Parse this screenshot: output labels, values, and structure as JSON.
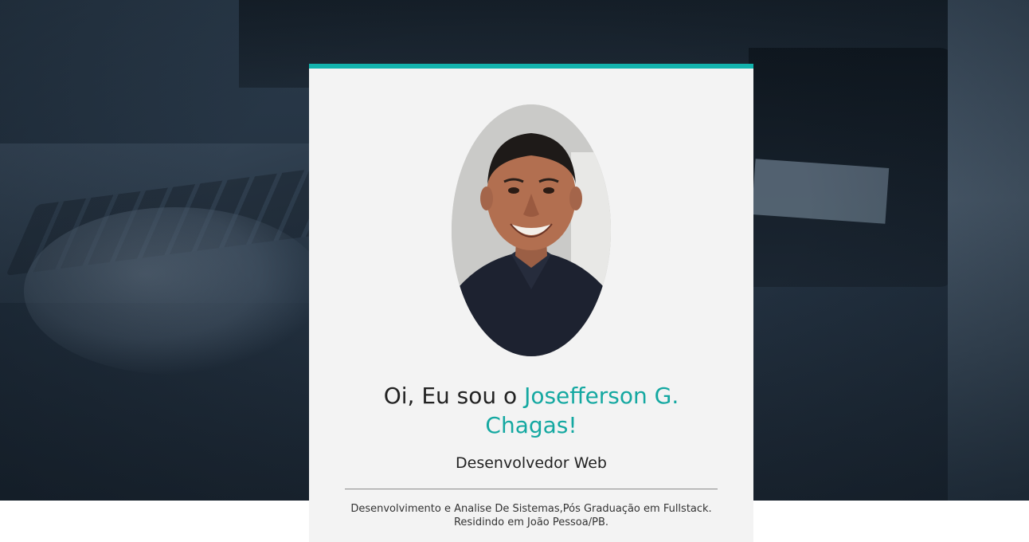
{
  "profile": {
    "greeting_prefix": "Oi, Eu sou o ",
    "name": "Josefferson G. Chagas!",
    "role": "Desenvolvedor Web",
    "bio": "Desenvolvimento e Analise De Sistemas,Pós Graduação em Fullstack. Residindo em João Pessoa/PB.",
    "photo_icon": "profile-photo"
  },
  "colors": {
    "accent": "#12b3ad",
    "name_color": "#14a8a1",
    "card_bg": "#f3f3f3",
    "text": "#222222"
  }
}
